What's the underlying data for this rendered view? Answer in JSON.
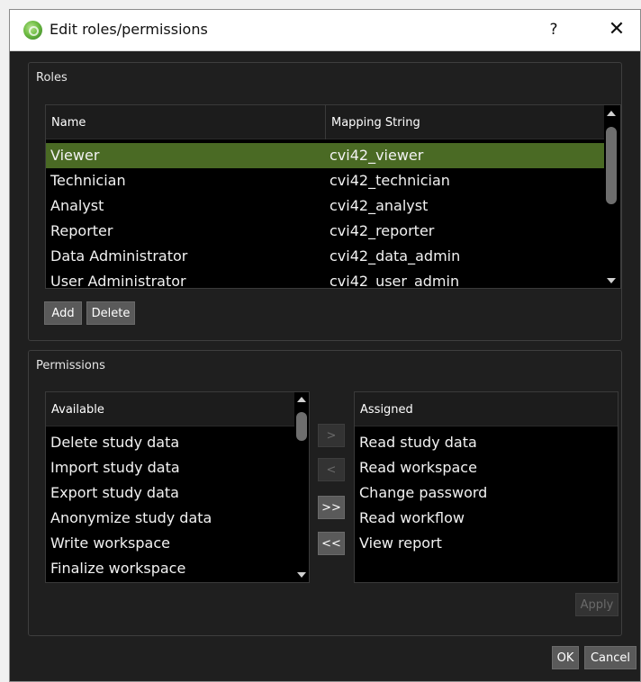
{
  "window": {
    "title": "Edit roles/permissions",
    "help_symbol": "?",
    "close_symbol": "✕",
    "app_icon": "green-orb-icon"
  },
  "roles": {
    "group_label": "Roles",
    "columns": [
      "Name",
      "Mapping String"
    ],
    "rows": [
      {
        "name": "Viewer",
        "mapping": "cvi42_viewer",
        "selected": true
      },
      {
        "name": "Technician",
        "mapping": "cvi42_technician",
        "selected": false
      },
      {
        "name": "Analyst",
        "mapping": "cvi42_analyst",
        "selected": false
      },
      {
        "name": "Reporter",
        "mapping": "cvi42_reporter",
        "selected": false
      },
      {
        "name": "Data Administrator",
        "mapping": "cvi42_data_admin",
        "selected": false
      },
      {
        "name": "User Administrator",
        "mapping": "cvi42_user_admin",
        "selected": false
      }
    ],
    "add_label": "Add",
    "delete_label": "Delete"
  },
  "permissions": {
    "group_label": "Permissions",
    "available_header": "Available",
    "available": [
      "Delete study data",
      "Import study data",
      "Export study data",
      "Anonymize study data",
      "Write workspace",
      "Finalize workspace"
    ],
    "assigned_header": "Assigned",
    "assigned": [
      "Read study data",
      "Read workspace",
      "Change password",
      "Read workflow",
      "View report"
    ],
    "move_right_label": ">",
    "move_left_label": "<",
    "move_all_right_label": ">>",
    "move_all_left_label": "<<",
    "apply_label": "Apply"
  },
  "footer": {
    "ok_label": "OK",
    "cancel_label": "Cancel"
  },
  "colors": {
    "background": "#1f1f1f",
    "selection": "#4a6a24",
    "button": "#5a5a5a"
  }
}
